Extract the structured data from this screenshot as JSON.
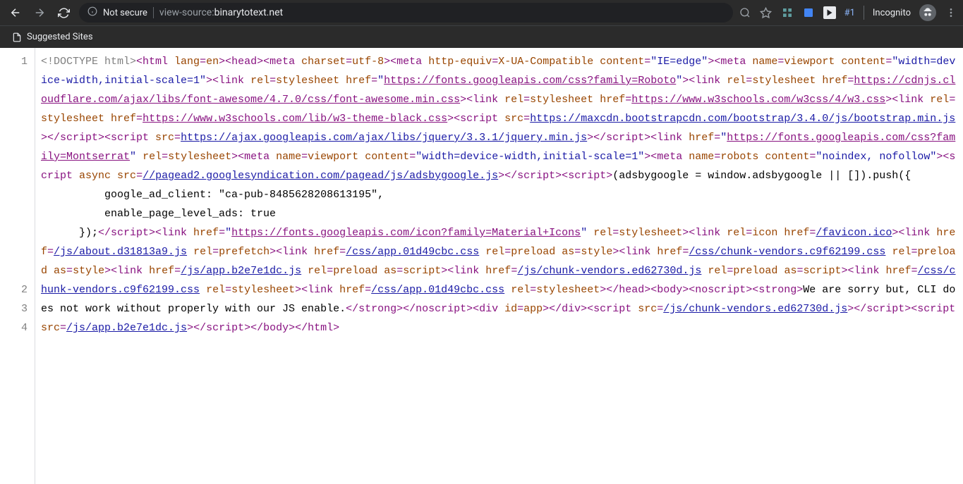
{
  "toolbar": {
    "secure_label": "Not secure",
    "url_prefix": "view-source:",
    "url_host": "binarytotext.net",
    "incognito_label": "Incognito",
    "blue_badge_text": "#1"
  },
  "bookmarks": {
    "item1": "Suggested Sites"
  },
  "line_numbers": [
    "1",
    "2",
    "3",
    "4"
  ],
  "source": {
    "doctype": "<!DOCTYPE html>",
    "links": {
      "roboto": "https://fonts.googleapis.com/css?family=Roboto",
      "fontawesome": "https://cdnjs.cloudflare.com/ajax/libs/font-awesome/4.7.0/css/font-awesome.min.css",
      "w3css": "https://www.w3schools.com/w3css/4/w3.css",
      "w3theme": "https://www.w3schools.com/lib/w3-theme-black.css",
      "bootstrap": "https://maxcdn.bootstrapcdn.com/bootstrap/3.4.0/js/bootstrap.min.js",
      "jquery": "https://ajax.googleapis.com/ajax/libs/jquery/3.3.1/jquery.min.js",
      "montserrat": "https://fonts.googleapis.com/css?family=Montserrat",
      "adsbygoogle": "//pagead2.googlesyndication.com/pagead/js/adsbygoogle.js",
      "materialicons": "https://fonts.googleapis.com/icon?family=Material+Icons",
      "favicon": "/favicon.ico",
      "aboutjs": "/js/about.d31813a9.js",
      "appcss": "/css/app.01d49cbc.css",
      "chunkvendorscss": "/css/chunk-vendors.c9f62199.css",
      "appjs": "/js/app.b2e7e1dc.js",
      "chunkvendorsjs": "/js/chunk-vendors.ed62730d.js"
    },
    "script_text": {
      "push_open": "(adsbygoogle = window.adsbygoogle || []).push({",
      "ad_client": "          google_ad_client: \"ca-pub-8485628208613195\",",
      "enable_ads": "          enable_page_level_ads: true",
      "close": "      });"
    },
    "noscript_text": "We are sorry but, CLI does not work without properly with our JS enable."
  }
}
